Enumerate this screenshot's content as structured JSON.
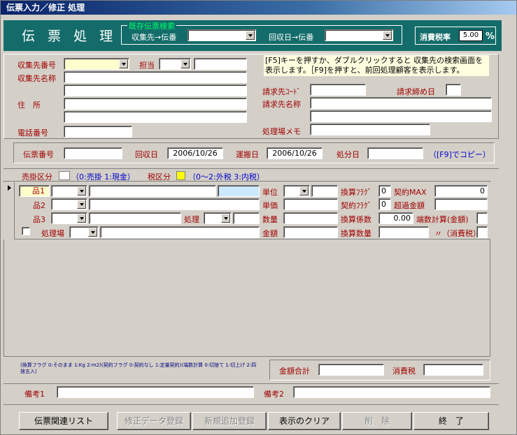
{
  "window": {
    "title": "伝票入力／修正 処理"
  },
  "banner": {
    "title": "伝 票 処 理",
    "search_group": "既存伝票検索",
    "label_collect_to_slip": "収集先→伝番",
    "label_date_to_slip": "回収日→伝番",
    "tax_label": "消費税率",
    "tax_value": "5.00",
    "tax_unit": "%"
  },
  "customer": {
    "collect_no_label": "収集先番号",
    "person_label": "担当",
    "collect_name_label": "収集先名称",
    "address_label": "住　所",
    "phone_label": "電話番号",
    "hint": "[F5]キーを押すか、ダブルクリックすると 収集先の検索画面を表示します。［F9]を押すと、前回処理顧客を表示します。",
    "billing_code_label": "請求先ｺｰﾄﾞ",
    "billing_close_label": "請求締め日",
    "billing_name_label": "請求先名称",
    "site_memo_label": "処理場メモ"
  },
  "slip": {
    "slip_no_label": "伝票番号",
    "collect_date_label": "回収日",
    "collect_date": "2006/10/26",
    "carry_date_label": "運搬日",
    "carry_date": "2006/10/26",
    "dispose_date_label": "処分日",
    "copy_hint": "（[F9]でコピー）"
  },
  "flags": {
    "sale_type_label": "売掛区分",
    "sale_type_hint": "（0:売掛 1:現金）",
    "tax_type_label": "税区分",
    "tax_type_hint": "（0～2:外税  3:内税）"
  },
  "detail": {
    "item1_label": "品1",
    "item2_label": "品2",
    "item3_label": "品3",
    "process_label": "処理",
    "plant_label": "処理場",
    "unit_label": "単位",
    "price_label": "単価",
    "qty_label": "数量",
    "amount_label": "金額",
    "conv_flag_label": "換算ﾌﾗｸﾞ",
    "conv_flag_value": "0",
    "contract_flag_label": "契約ﾌﾗｸﾞ",
    "contract_flag_value": "0",
    "conv_factor_label": "換算係数",
    "conv_factor_value": "0.00",
    "conv_qty_label": "換算数量",
    "contract_max_label": "契約MAX",
    "contract_max_value": "0",
    "over_amount_label": "超過金額",
    "rounding_amount_label": "端数計算(金額)",
    "rounding_tax_label": "〃（消費税）"
  },
  "footer": {
    "note": "(換算フラグ 0:そのまま 1:Kg 2:m2)(契約フラグ 0:契約なし 1:定量契約)(端数計算 0:切捨て 1:切上げ 2:四捨五入)",
    "total_label": "金額合計",
    "tax_label": "消費税",
    "remark1_label": "備考1",
    "remark2_label": "備考2"
  },
  "buttons": {
    "related_list": "伝票関連リスト",
    "save_edit": "修正データ登録",
    "save_new": "新規追加登録",
    "clear": "表示のクリア",
    "delete": "削　除",
    "exit": "終　了"
  },
  "colors": {
    "banner": "#136c6a",
    "legend": "#00ff66",
    "label_red": "#a00000",
    "hint_blue": "#0000cc"
  }
}
